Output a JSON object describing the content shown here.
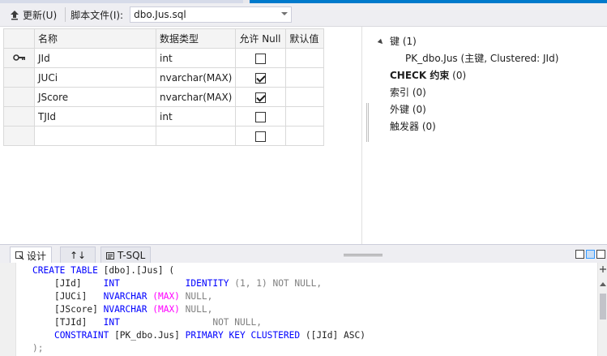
{
  "toolbar": {
    "update_label": "更新(U)",
    "script_file_label": "脚本文件(I):",
    "script_file_value": "dbo.Jus.sql"
  },
  "grid": {
    "headers": [
      "名称",
      "数据类型",
      "允许 Null",
      "默认值"
    ],
    "rows": [
      {
        "name": "JId",
        "type": "int",
        "allow_null": false,
        "default": "",
        "primary_key": true
      },
      {
        "name": "JUCi",
        "type": "nvarchar(MAX)",
        "allow_null": true,
        "default": "",
        "primary_key": false
      },
      {
        "name": "JScore",
        "type": "nvarchar(MAX)",
        "allow_null": true,
        "default": "",
        "primary_key": false
      },
      {
        "name": "TJId",
        "type": "int",
        "allow_null": false,
        "default": "",
        "primary_key": false
      },
      {
        "name": "",
        "type": "",
        "allow_null": false,
        "default": "",
        "primary_key": false
      }
    ]
  },
  "properties": {
    "keys": "键 (1)",
    "pk": "PK_dbo.Jus",
    "pk_detail": "(主键, Clustered: JId)",
    "check_label": "CHECK 约束",
    "check_count": "(0)",
    "indexes": "索引 (0)",
    "foreign_keys": "外键 (0)",
    "triggers": "触发器 (0)"
  },
  "tabs": {
    "design": "设计",
    "swap": "↑↓",
    "tsql": "T-SQL"
  },
  "sql": {
    "l1a": "CREATE TABLE",
    "l1b": "[dbo].[Jus] (",
    "l2a": "[JId]",
    "l2b": "INT",
    "l2c": "IDENTITY",
    "l2d": "(1, 1)",
    "l2e": "NOT NULL,",
    "l3a": "[JUCi]",
    "l3b": "NVARCHAR",
    "l3c": "(MAX)",
    "l3d": "NULL,",
    "l4a": "[JScore]",
    "l4b": "NVARCHAR",
    "l4c": "(MAX)",
    "l4d": "NULL,",
    "l5a": "[TJId]",
    "l5b": "INT",
    "l5c": "NOT NULL,",
    "l6a": "CONSTRAINT",
    "l6b": "[PK_dbo.Jus]",
    "l6c": "PRIMARY KEY CLUSTERED",
    "l6d": "([JId] ASC)",
    "l7": ");"
  },
  "colors": {
    "keyword": "#0000ff",
    "function": "#ff00ff",
    "gray": "#808080",
    "accent": "#007acc"
  }
}
